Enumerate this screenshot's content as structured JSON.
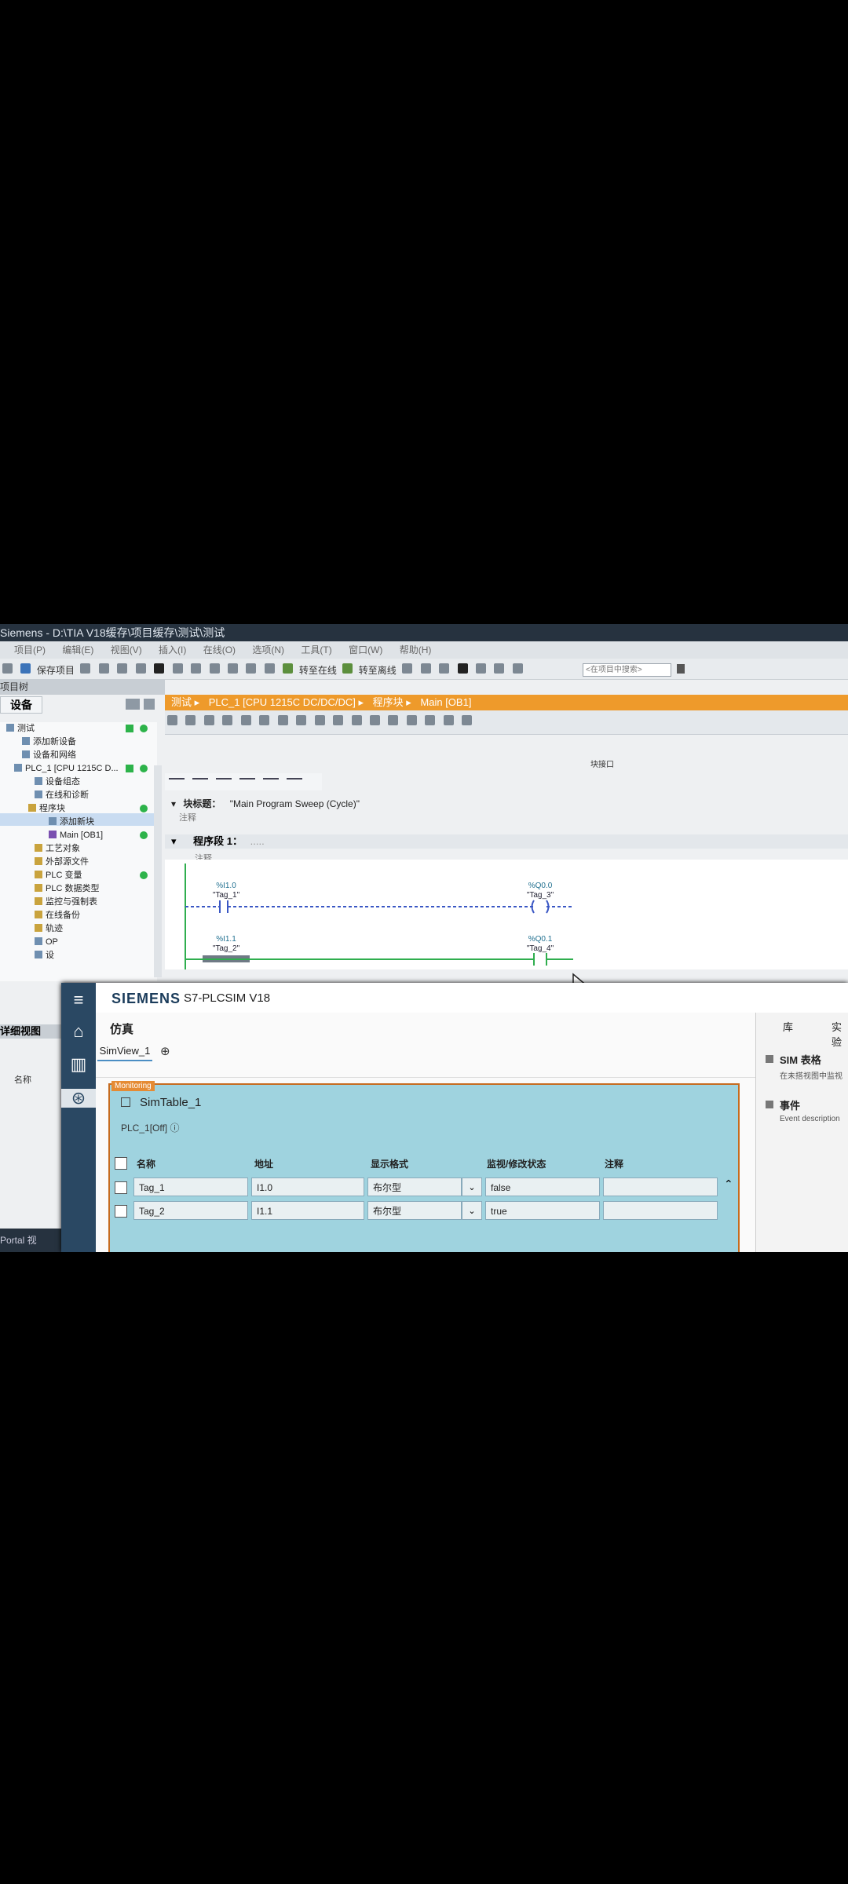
{
  "window": {
    "title": "Siemens  -  D:\\TIA V18缓存\\项目缓存\\测试\\测试"
  },
  "menu": [
    "项目(P)",
    "编辑(E)",
    "视图(V)",
    "插入(I)",
    "在线(O)",
    "选项(N)",
    "工具(T)",
    "窗口(W)",
    "帮助(H)"
  ],
  "toolbar": {
    "save": "保存项目",
    "go_online": "转至在线",
    "go_offline": "转至离线",
    "search_placeholder": "<在项目中搜索>"
  },
  "project_tree": {
    "header": "项目树",
    "tab": "设备",
    "items": [
      {
        "label": "测试",
        "indent": 0
      },
      {
        "label": "添加新设备",
        "indent": 1
      },
      {
        "label": "设备和网络",
        "indent": 1
      },
      {
        "label": "PLC_1 [CPU 1215C D...",
        "indent": 1
      },
      {
        "label": "设备组态",
        "indent": 2
      },
      {
        "label": "在线和诊断",
        "indent": 2
      },
      {
        "label": "程序块",
        "indent": 2
      },
      {
        "label": "添加新块",
        "indent": 3
      },
      {
        "label": "Main [OB1]",
        "indent": 3
      },
      {
        "label": "工艺对象",
        "indent": 2
      },
      {
        "label": "外部源文件",
        "indent": 2
      },
      {
        "label": "PLC 变量",
        "indent": 2
      },
      {
        "label": "PLC 数据类型",
        "indent": 2
      },
      {
        "label": "监控与强制表",
        "indent": 2
      },
      {
        "label": "在线备份",
        "indent": 2
      },
      {
        "label": "轨迹",
        "indent": 2
      },
      {
        "label": "OP",
        "indent": 2
      },
      {
        "label": "设",
        "indent": 2
      }
    ],
    "detail_view": "详细视图",
    "detail_col": "名称",
    "portal": "Portal 视"
  },
  "editor": {
    "breadcrumb": [
      "测试",
      "PLC_1 [CPU 1215C DC/DC/DC]",
      "程序块",
      "Main [OB1]"
    ],
    "block_interface": "块接口",
    "block_title_label": "块标题：",
    "block_title_value": "\"Main Program Sweep (Cycle)\"",
    "comment": "注释",
    "network_label": "程序段 1：",
    "network_dots": ".....",
    "rungs": [
      {
        "in_addr": "%I1.0",
        "in_tag": "\"Tag_1\"",
        "out_addr": "%Q0.0",
        "out_tag": "\"Tag_3\"",
        "state": "off"
      },
      {
        "in_addr": "%I1.1",
        "in_tag": "\"Tag_2\"",
        "out_addr": "%Q0.1",
        "out_tag": "\"Tag_4\"",
        "state": "on"
      }
    ]
  },
  "plcsim": {
    "brand": "SIEMENS",
    "product": "S7-PLCSIM V18",
    "section": "仿真",
    "tab": "SimView_1",
    "add_tab": "⊕",
    "monitoring": "Monitoring",
    "table_title": "SimTable_1",
    "plc_state": "PLC_1[Off]",
    "columns": [
      "名称",
      "地址",
      "显示格式",
      "监视/修改状态",
      "注释"
    ],
    "rows": [
      {
        "name": "Tag_1",
        "address": "I1.0",
        "format": "布尔型",
        "value": "false",
        "comment": ""
      },
      {
        "name": "Tag_2",
        "address": "I1.1",
        "format": "布尔型",
        "value": "true",
        "comment": ""
      }
    ],
    "right_tabs": [
      "库",
      "实验"
    ],
    "right_sections": [
      {
        "title": "SIM 表格",
        "desc": "在未搭视图中监视"
      },
      {
        "title": "事件",
        "desc": "Event description"
      }
    ]
  }
}
